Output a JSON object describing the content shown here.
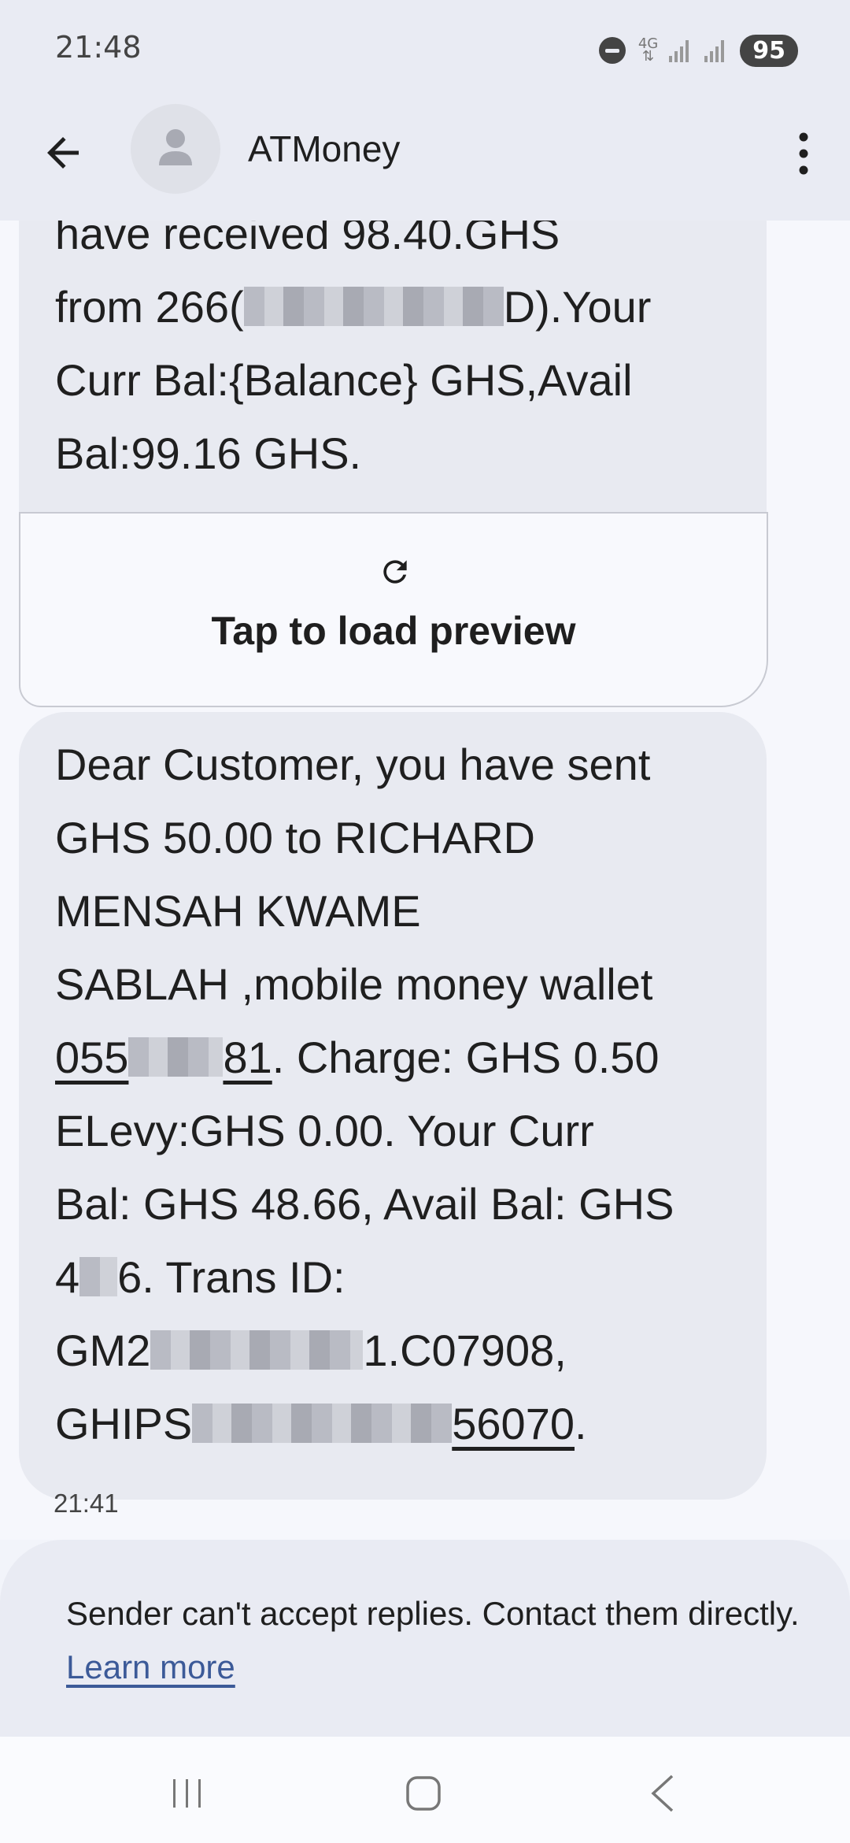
{
  "status_bar": {
    "time": "21:48",
    "network": "4G",
    "battery": "95",
    "icons": [
      "do-not-disturb-icon",
      "network-4g-icon",
      "signal-icon",
      "signal-icon",
      "battery-icon"
    ]
  },
  "header": {
    "contact_name": "ATMoney",
    "icons": [
      "back-arrow-icon",
      "person-icon",
      "more-vert-icon"
    ]
  },
  "messages": {
    "bubble_1": {
      "line_1": "have received 98.40.GHS",
      "line_2_prefix": "from 266(",
      "line_2_suffix": "D).Your",
      "line_3": "Curr Bal:{Balance} GHS,Avail",
      "line_4": "Bal:99.16 GHS."
    },
    "preview": {
      "icon": "refresh-icon",
      "label": "Tap to load preview"
    },
    "bubble_2": {
      "line_1": "Dear Customer, you have sent",
      "line_2": "GHS 50.00 to RICHARD",
      "line_3": "MENSAH KWAME",
      "line_4": "SABLAH ,mobile money wallet",
      "line_5_link_prefix": "055",
      "line_5_link_suffix": "81",
      "line_5_rest": ". Charge: GHS 0.50",
      "line_6": "ELevy:GHS 0.00. Your Curr",
      "line_7": "Bal: GHS 48.66, Avail Bal: GHS",
      "line_8_prefix": "4",
      "line_8_suffix": "6. Trans ID:",
      "line_9_prefix": "GM2",
      "line_9_suffix": "1.C07908,",
      "line_10_prefix": "GHIPS",
      "line_10_link_suffix": "56070",
      "line_10_end": "."
    },
    "timestamp": "21:41"
  },
  "reply_notice": {
    "text": "Sender can't accept replies. Contact them directly.",
    "link": "Learn more"
  },
  "nav_bar": {
    "icons": [
      "recents-icon",
      "home-icon",
      "back-icon"
    ]
  },
  "colors": {
    "background": "#f2f4fa",
    "bubble": "#e8eaf1",
    "link": "#3c5a98"
  }
}
